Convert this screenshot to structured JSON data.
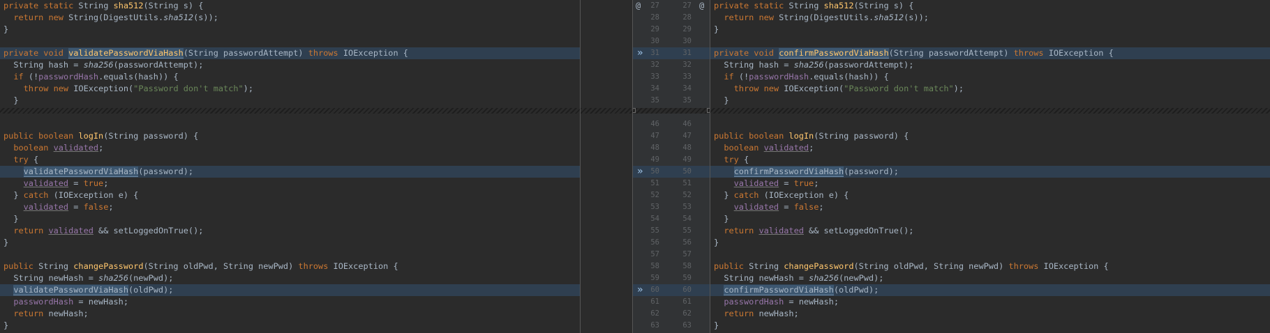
{
  "gutter": {
    "at_marker": "@",
    "arrow_glyph": "»",
    "top_lines": [
      "27",
      "28",
      "29",
      "30",
      "31",
      "32",
      "33",
      "34",
      "35"
    ],
    "bottom_lines": [
      "46",
      "47",
      "48",
      "49",
      "50",
      "51",
      "52",
      "53",
      "54",
      "55",
      "56",
      "57",
      "58",
      "59",
      "60",
      "61",
      "62",
      "63"
    ]
  },
  "left": {
    "method1_sig": "private static String sha512(String s) {",
    "method1_body": "return new String(DigestUtils.sha512(s));",
    "close_brace": "}",
    "validate_name": "validatePasswordViaHash",
    "changepw_call_name": "validatePasswordViaHash"
  },
  "right": {
    "validate_name": "confirmPasswordViaHash",
    "changepw_call_name": "confirmPasswordViaHash"
  },
  "common": {
    "kw_private": "private",
    "kw_static": "static",
    "kw_void": "void",
    "kw_return": "return",
    "kw_new": "new",
    "kw_throws": "throws",
    "kw_if": "if",
    "kw_throw": "throw",
    "kw_public": "public",
    "kw_boolean": "boolean",
    "kw_try": "try",
    "kw_catch": "catch",
    "kw_true": "true",
    "kw_false": "false",
    "t_string": "String",
    "fn_sha512": "sha512",
    "fn_sha256": "sha256",
    "fn_login": "logIn",
    "fn_changepw": "changePassword",
    "field_passwordHash": "passwordHash",
    "var_validated": "validated",
    "str_mismatch": "\"Password don't match\"",
    "ioexception": "IOException",
    "digestutils": "DigestUtils.",
    "p_s": "(String s) {",
    "p_attempt": "(String passwordAttempt)",
    "p_attempt_call": "(passwordAttempt);",
    "p_password": "(String password) {",
    "p_password_call": "(password);",
    "p_oldnew": "(String oldPwd, String newPwd)",
    "p_newpwd": "(newPwd);",
    "p_oldpwd": "(oldPwd);",
    "t_new_string_open": "String(",
    "t_s_close": "(s));",
    "t_hash_assign": "String hash = ",
    "t_equals": ".equals(hash)) {",
    "t_not_open": "(!",
    "t_ioexc_open": "IOException(",
    "t_close_semicolon": ");",
    "t_brace_open": "{",
    "t_brace_close": "}",
    "t_semicolon": ";",
    "t_assign": " = ",
    "t_catch_rest": "(IOException e) {",
    "t_close_brace_catch": "} ",
    "t_and_login": " && setLoggedOnTrue();",
    "t_newhash_assign": "String newHash = ",
    "t_newhash_return": " newHash;",
    "t_assign_newhash": " = newHash;"
  }
}
